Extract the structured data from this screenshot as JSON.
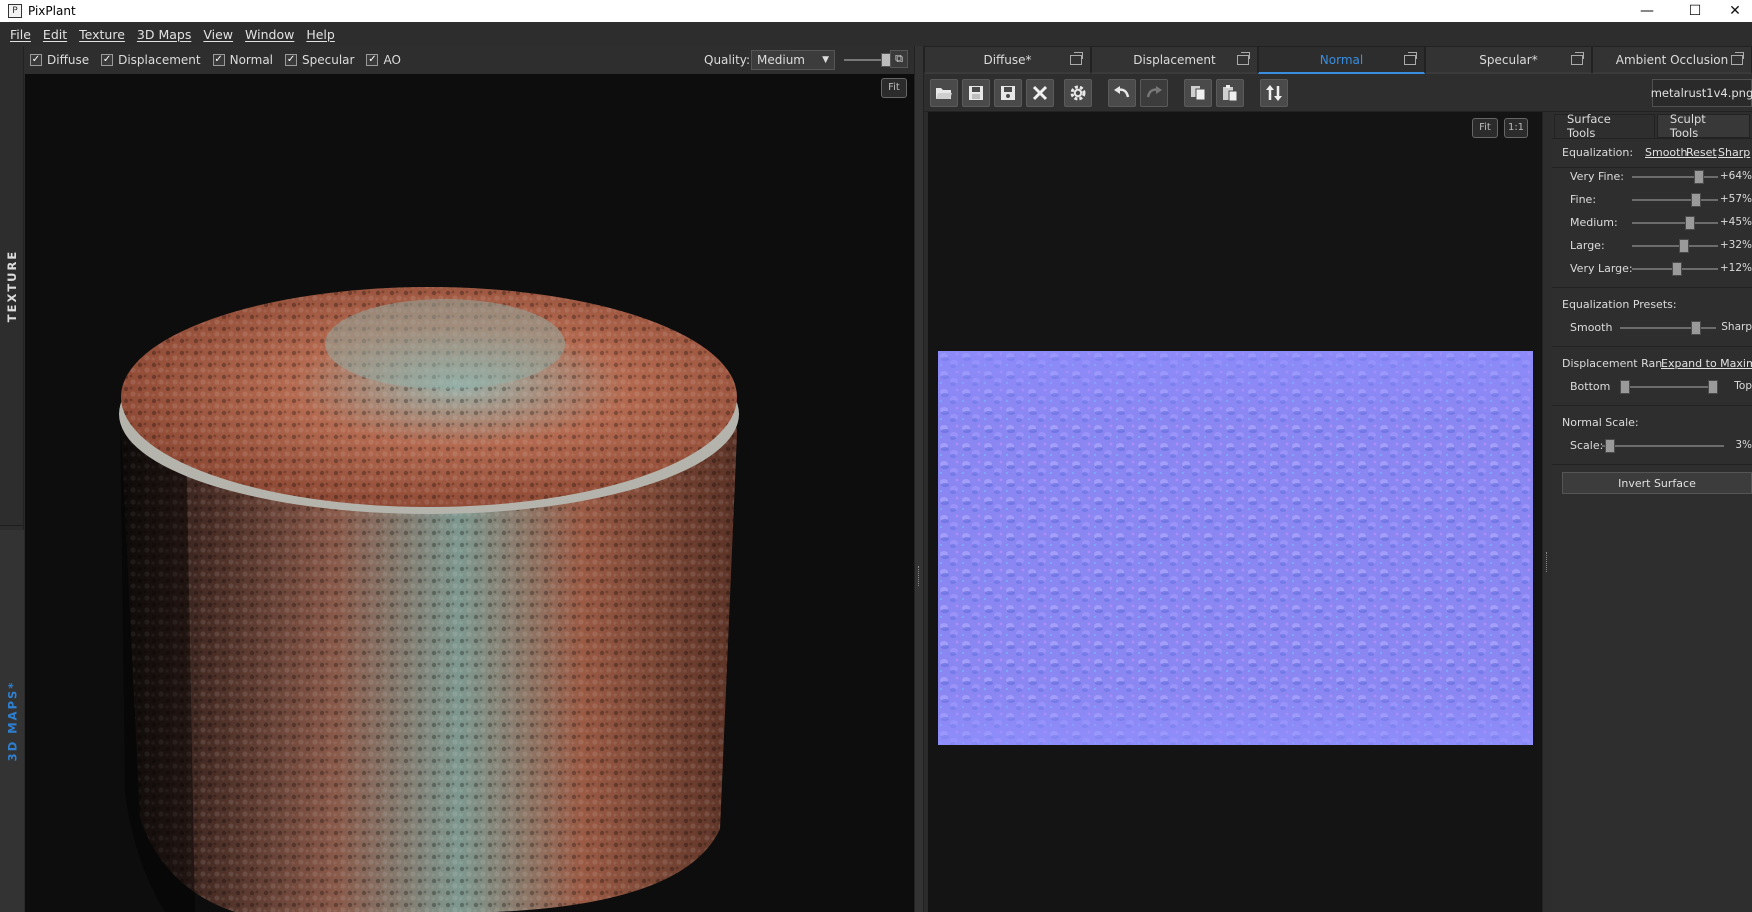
{
  "window": {
    "title": "PixPlant",
    "controls": [
      "—",
      "☐",
      "✕"
    ]
  },
  "menu": [
    {
      "label": "File"
    },
    {
      "label": "Edit"
    },
    {
      "label": "Texture"
    },
    {
      "label": "3D Maps"
    },
    {
      "label": "View"
    },
    {
      "label": "Window"
    },
    {
      "label": "Help"
    }
  ],
  "side_tabs": {
    "texture": "TEXTURE",
    "maps3d": "3D MAPS*"
  },
  "view_toolbar": {
    "checks": [
      {
        "label": "Diffuse",
        "checked": true
      },
      {
        "label": "Displacement",
        "checked": true
      },
      {
        "label": "Normal",
        "checked": true
      },
      {
        "label": "Specular",
        "checked": true
      },
      {
        "label": "AO",
        "checked": true
      }
    ],
    "quality_label": "Quality:",
    "quality_value": "Medium",
    "quality_slider": 0.8,
    "fit_label": "Fit"
  },
  "map_tabs": [
    {
      "label": "Diffuse*",
      "active": false
    },
    {
      "label": "Displacement",
      "active": false
    },
    {
      "label": "Normal",
      "active": true
    },
    {
      "label": "Specular*",
      "active": false
    },
    {
      "label": "Ambient Occlusion",
      "active": false
    }
  ],
  "map_toolbar": {
    "buttons": [
      {
        "name": "open-folder-icon"
      },
      {
        "name": "save-icon"
      },
      {
        "name": "save-as-icon"
      },
      {
        "name": "close-icon"
      },
      {
        "name": "gear-icon"
      },
      {
        "name": "undo-icon"
      },
      {
        "name": "redo-icon"
      },
      {
        "name": "copy-icon"
      },
      {
        "name": "paste-icon"
      },
      {
        "name": "swap-icon"
      }
    ],
    "filename": "metalrust1v4.png"
  },
  "view2d": {
    "fit_label": "Fit",
    "one_label": "1:1"
  },
  "tools": {
    "tabs": [
      {
        "label": "Surface Tools",
        "active": true
      },
      {
        "label": "Sculpt Tools",
        "active": false
      }
    ],
    "equalization": {
      "label": "Equalization:",
      "links": [
        "Smooth",
        "Reset",
        "Sharp"
      ],
      "sliders": [
        {
          "label": "Very Fine:",
          "value": "+64%",
          "pos": 0.82
        },
        {
          "label": "Fine:",
          "value": "+57%",
          "pos": 0.78
        },
        {
          "label": "Medium:",
          "value": "+45%",
          "pos": 0.7
        },
        {
          "label": "Large:",
          "value": "+32%",
          "pos": 0.62
        },
        {
          "label": "Very Large:",
          "value": "+12%",
          "pos": 0.52
        }
      ]
    },
    "presets": {
      "label": "Equalization Presets:",
      "left": "Smooth",
      "right": "Sharp",
      "pos": 0.82
    },
    "displacement": {
      "label": "Displacement Ran",
      "link": "Expand to Maxim",
      "left": "Bottom",
      "right": "Top",
      "pos_low": 0.0,
      "pos_high": 1.0
    },
    "normal_scale": {
      "label": "Normal Scale:",
      "scale_label": "Scale:",
      "value": "3%",
      "pos": 0.03
    },
    "invert_label": "Invert Surface"
  }
}
